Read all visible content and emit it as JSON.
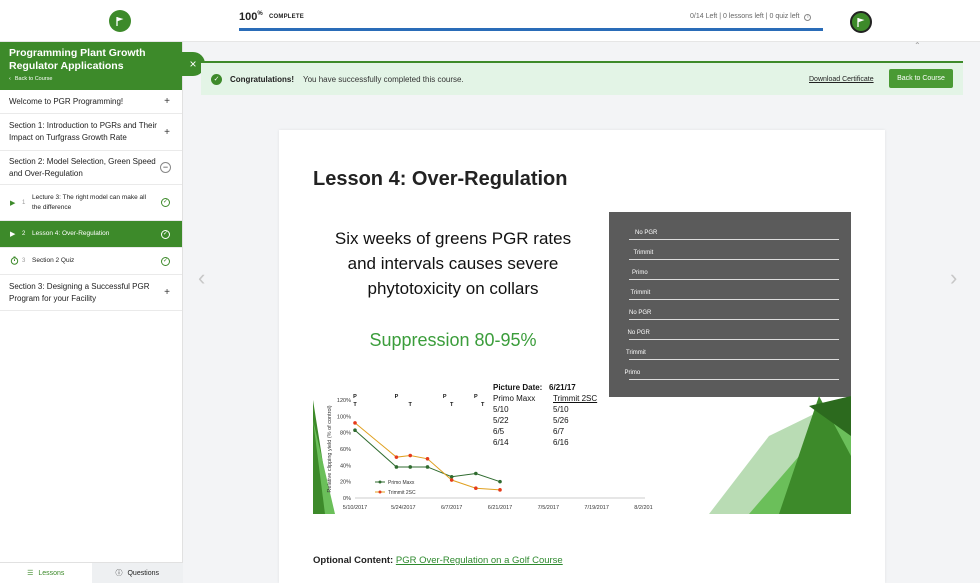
{
  "header": {
    "progress_percent": "100",
    "progress_unit": "%",
    "progress_label": "COMPLETE",
    "progress_fraction": 1.0,
    "stats": "0/14 Left  | 0 lessons left  | 0 quiz left",
    "info_glyph": "i",
    "logo_icon": "flag-icon",
    "avatar_icon": "flag-icon"
  },
  "sidebar": {
    "course_title": "Programming Plant Growth Regulator Applications",
    "back_label": "Back to Course",
    "close_glyph": "×",
    "sections": [
      {
        "label": "Welcome to PGR Programming!",
        "toggle": "+"
      },
      {
        "label": "Section 1: Introduction to PGRs and Their Impact on Turfgrass Growth Rate",
        "toggle": "+"
      },
      {
        "label": "Section 2: Model Selection, Green Speed and Over-Regulation",
        "toggle": "−"
      },
      {
        "label": "Section 3: Designing a Successful PGR Program for your Facility",
        "toggle": "+"
      }
    ],
    "lessons": [
      {
        "num": "1",
        "title": "Lecture 3: The right model can make all the difference",
        "check": "✓"
      },
      {
        "num": "2",
        "title": "Lesson 4: Over-Regulation",
        "check": "✓"
      },
      {
        "num": "3",
        "title": "Section 2 Quiz",
        "check": "✓"
      }
    ],
    "tabs": {
      "lessons": "Lessons",
      "questions": "Questions"
    }
  },
  "banner": {
    "check_glyph": "✓",
    "title": "Congratulations!",
    "message": "You have successfully completed this course.",
    "download": "Download Certificate",
    "back": "Back to Course"
  },
  "lesson": {
    "title": "Lesson 4: Over-Regulation",
    "slide": {
      "headline_lines": [
        "Six weeks of greens PGR rates",
        "and intervals causes severe",
        "phytotoxicity on collars"
      ],
      "suppression": "Suppression 80-95%",
      "photo_labels": [
        "No PGR",
        "Trimmit",
        "Primo",
        "Trimmit",
        "No PGR",
        "No PGR",
        "Trimmit",
        "Primo"
      ],
      "picture_date_label": "Picture Date:",
      "picture_date": "6/21/17",
      "table_headers": [
        "Primo Maxx",
        "Trimmit 2SC"
      ],
      "table_rows": [
        [
          "5/10",
          "5/10"
        ],
        [
          "5/22",
          "5/26"
        ],
        [
          "6/5",
          "6/7"
        ],
        [
          "6/14",
          "6/16"
        ]
      ]
    },
    "optional_label": "Optional Content:",
    "optional_link": "PGR Over-Regulation on a Golf Course"
  },
  "chart_data": {
    "type": "line",
    "ylabel": "Relative clipping yield (% of control)",
    "yticks": [
      "0%",
      "20%",
      "40%",
      "60%",
      "80%",
      "100%",
      "120%"
    ],
    "ylim": [
      0,
      120
    ],
    "xticks": [
      "5/10/2017",
      "5/24/2017",
      "6/7/2017",
      "6/21/2017",
      "7/5/2017",
      "7/19/2017",
      "8/2/2017"
    ],
    "application_markers": {
      "primo": "P",
      "trimmit": "T"
    },
    "series": [
      {
        "name": "Primo Maxx",
        "color": "#2f6b2f",
        "points": [
          [
            "5/10/2017",
            83
          ],
          [
            "5/22/2017",
            38
          ],
          [
            "5/26/2017",
            38
          ],
          [
            "5/31/2017",
            38
          ],
          [
            "6/7/2017",
            26
          ],
          [
            "6/14/2017",
            30
          ],
          [
            "6/21/2017",
            20
          ]
        ]
      },
      {
        "name": "Trimmit 2SC",
        "color": "#e53a1a",
        "points": [
          [
            "5/10/2017",
            92
          ],
          [
            "5/22/2017",
            50
          ],
          [
            "5/26/2017",
            52
          ],
          [
            "5/31/2017",
            48
          ],
          [
            "6/7/2017",
            22
          ],
          [
            "6/14/2017",
            12
          ],
          [
            "6/21/2017",
            10
          ]
        ]
      }
    ]
  }
}
